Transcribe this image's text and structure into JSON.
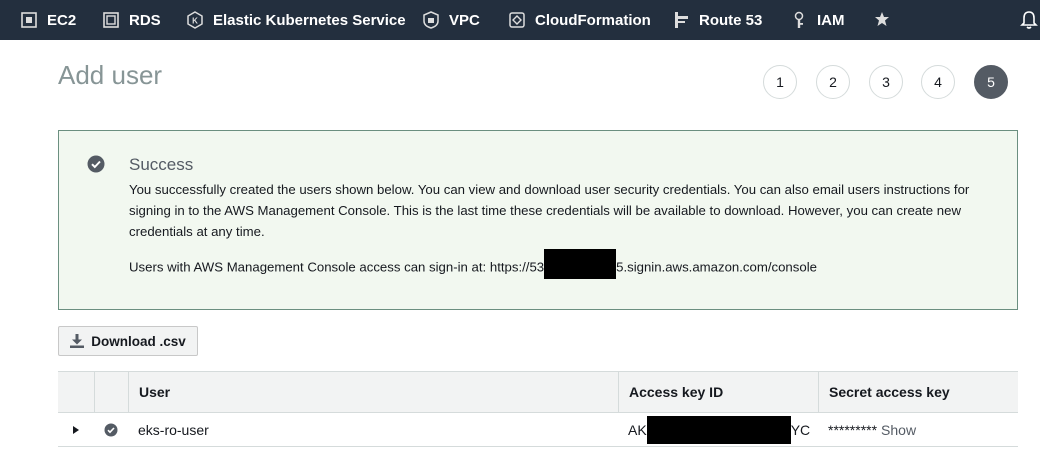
{
  "nav": {
    "items": [
      {
        "label": "EC2",
        "icon": "ec2-icon"
      },
      {
        "label": "RDS",
        "icon": "rds-icon"
      },
      {
        "label": "Elastic Kubernetes Service",
        "icon": "eks-icon"
      },
      {
        "label": "VPC",
        "icon": "vpc-icon"
      },
      {
        "label": "CloudFormation",
        "icon": "cloudformation-icon"
      },
      {
        "label": "Route 53",
        "icon": "route53-icon"
      },
      {
        "label": "IAM",
        "icon": "iam-icon"
      }
    ],
    "pin_icon": "pin-icon",
    "bell_icon": "bell-icon",
    "background": "#232f3e"
  },
  "page": {
    "title": "Add user",
    "steps": [
      "1",
      "2",
      "3",
      "4",
      "5"
    ],
    "active_step": "5"
  },
  "success": {
    "title": "Success",
    "message": "You successfully created the users shown below. You can view and download user security credentials. You can also email users instructions for signing in to the AWS Management Console. This is the last time these credentials will be available to download. However, you can create new credentials at any time.",
    "signin_prefix": "Users with AWS Management Console access can sign-in at: https://53",
    "signin_suffix": "5.signin.aws.amazon.com/console",
    "border_color": "#6b8f80",
    "background": "#f2f8f0"
  },
  "download_button": {
    "label": "Download .csv"
  },
  "table": {
    "headers": [
      "User",
      "Access key ID",
      "Secret access key"
    ],
    "rows": [
      {
        "user": "eks-ro-user",
        "access_key_prefix": "AK",
        "access_key_suffix": "YC",
        "secret_masked": "*********",
        "show_label": "Show"
      }
    ]
  }
}
